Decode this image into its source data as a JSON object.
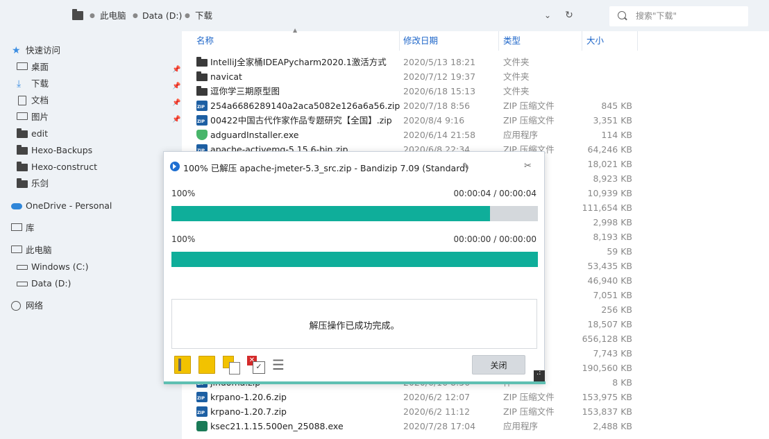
{
  "address": {
    "crumbs": [
      "此电脑",
      "Data (D:)",
      "下载"
    ],
    "search_placeholder": "搜索\"下载\""
  },
  "sidebar": {
    "quick_access": "快速访问",
    "items": [
      {
        "label": "桌面",
        "icon": "desktop-icon",
        "pinned": true
      },
      {
        "label": "下载",
        "icon": "download-icon",
        "pinned": true
      },
      {
        "label": "文档",
        "icon": "document-icon",
        "pinned": true
      },
      {
        "label": "图片",
        "icon": "picture-icon",
        "pinned": true
      },
      {
        "label": "edit",
        "icon": "folder-icon"
      },
      {
        "label": "Hexo-Backups",
        "icon": "folder-icon"
      },
      {
        "label": "Hexo-construct",
        "icon": "folder-icon"
      },
      {
        "label": "乐剑",
        "icon": "folder-icon"
      }
    ],
    "onedrive": "OneDrive - Personal",
    "library": "库",
    "this_pc": "此电脑",
    "drives": [
      "Windows (C:)",
      "Data (D:)"
    ],
    "network": "网络"
  },
  "columns": {
    "name": "名称",
    "date": "修改日期",
    "type": "类型",
    "size": "大小"
  },
  "files": [
    {
      "name": "IntelliJ全家桶IDEAPycharm2020.1激活方式",
      "date": "2020/5/13 18:21",
      "type": "文件夹",
      "size": "",
      "icon": "folder"
    },
    {
      "name": "navicat",
      "date": "2020/7/12 19:37",
      "type": "文件夹",
      "size": "",
      "icon": "folder"
    },
    {
      "name": "逗你学三期原型图",
      "date": "2020/6/18 15:13",
      "type": "文件夹",
      "size": "",
      "icon": "folder"
    },
    {
      "name": "254a6686289140a2aca5082e126a6a56.zip",
      "date": "2020/7/18 8:56",
      "type": "ZIP 压缩文件",
      "size": "845 KB",
      "icon": "zip"
    },
    {
      "name": "00422中国古代作家作品专题研究【全国】.zip",
      "date": "2020/8/4 9:16",
      "type": "ZIP 压缩文件",
      "size": "3,351 KB",
      "icon": "zip"
    },
    {
      "name": "adguardInstaller.exe",
      "date": "2020/6/14 21:58",
      "type": "应用程序",
      "size": "114 KB",
      "icon": "shield"
    },
    {
      "name": "apache-activemq-5.15.6-bin.zip",
      "date": "2020/6/8 22:34",
      "type": "ZIP 压缩文件",
      "size": "64,246 KB",
      "icon": "zip"
    },
    {
      "name": "",
      "date": "",
      "type": "件",
      "size": "18,021 KB",
      "icon": ""
    },
    {
      "name": "",
      "date": "",
      "type": "件",
      "size": "8,923 KB",
      "icon": ""
    },
    {
      "name": "",
      "date": "",
      "type": "件",
      "size": "10,939 KB",
      "icon": ""
    },
    {
      "name": "",
      "date": "",
      "type": "",
      "size": "111,654 KB",
      "icon": ""
    },
    {
      "name": "",
      "date": "",
      "type": "件",
      "size": "2,998 KB",
      "icon": ""
    },
    {
      "name": "",
      "date": "",
      "type": "件",
      "size": "8,193 KB",
      "icon": ""
    },
    {
      "name": "",
      "date": "",
      "type": "件",
      "size": "59 KB",
      "icon": ""
    },
    {
      "name": "",
      "date": "",
      "type": "",
      "size": "53,435 KB",
      "icon": ""
    },
    {
      "name": "",
      "date": "",
      "type": "",
      "size": "46,940 KB",
      "icon": ""
    },
    {
      "name": "",
      "date": "",
      "type": "",
      "size": "7,051 KB",
      "icon": ""
    },
    {
      "name": "",
      "date": "",
      "type": "件",
      "size": "256 KB",
      "icon": ""
    },
    {
      "name": "",
      "date": "",
      "type": "",
      "size": "18,507 KB",
      "icon": ""
    },
    {
      "name": "",
      "date": "",
      "type": "",
      "size": "656,128 KB",
      "icon": ""
    },
    {
      "name": "",
      "date": "",
      "type": "件",
      "size": "7,743 KB",
      "icon": ""
    },
    {
      "name": "",
      "date": "",
      "type": "件",
      "size": "190,560 KB",
      "icon": ""
    },
    {
      "name": "jinuoma.zip",
      "date": "2020/6/16 8:56",
      "type": "件",
      "size": "8 KB",
      "icon": "zip"
    },
    {
      "name": "krpano-1.20.6.zip",
      "date": "2020/6/2 12:07",
      "type": "ZIP 压缩文件",
      "size": "153,975 KB",
      "icon": "zip"
    },
    {
      "name": "krpano-1.20.7.zip",
      "date": "2020/6/2 11:12",
      "type": "ZIP 压缩文件",
      "size": "153,837 KB",
      "icon": "zip"
    },
    {
      "name": "ksec21.1.15.500en_25088.exe",
      "date": "2020/7/28 17:04",
      "type": "应用程序",
      "size": "2,488 KB",
      "icon": "hex"
    }
  ],
  "dialog": {
    "title": "100% 已解压 apache-jmeter-5.3_src.zip - Bandizip 7.09 (Standard)",
    "progress1": {
      "percent_label": "100%",
      "time": "00:00:04 / 00:00:04",
      "fill": 0.87
    },
    "progress2": {
      "percent_label": "100%",
      "time": "00:00:00 / 00:00:00",
      "fill": 1.0
    },
    "message": "解压操作已成功完成。",
    "close_label": "关闭",
    "accent": "#0fae9a"
  }
}
